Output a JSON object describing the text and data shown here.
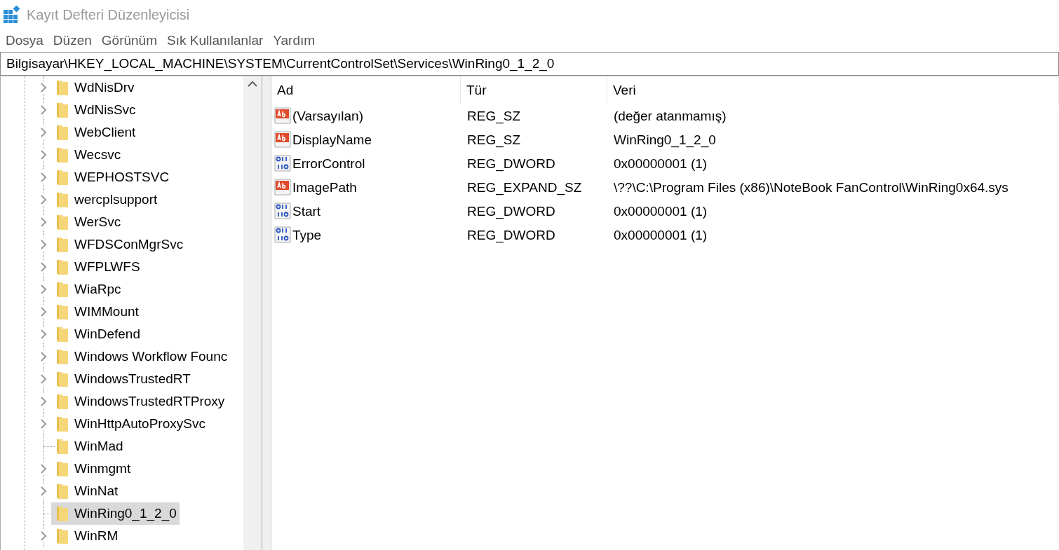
{
  "window": {
    "title": "Kayıt Defteri Düzenleyicisi"
  },
  "menu": [
    "Dosya",
    "Düzen",
    "Görünüm",
    "Sık Kullanılanlar",
    "Yardım"
  ],
  "address": "Bilgisayar\\HKEY_LOCAL_MACHINE\\SYSTEM\\CurrentControlSet\\Services\\WinRing0_1_2_0",
  "tree": [
    {
      "label": "WdNisDrv",
      "expandable": true,
      "selected": false
    },
    {
      "label": "WdNisSvc",
      "expandable": true,
      "selected": false
    },
    {
      "label": "WebClient",
      "expandable": true,
      "selected": false
    },
    {
      "label": "Wecsvc",
      "expandable": true,
      "selected": false
    },
    {
      "label": "WEPHOSTSVC",
      "expandable": true,
      "selected": false
    },
    {
      "label": "wercplsupport",
      "expandable": true,
      "selected": false
    },
    {
      "label": "WerSvc",
      "expandable": true,
      "selected": false
    },
    {
      "label": "WFDSConMgrSvc",
      "expandable": true,
      "selected": false
    },
    {
      "label": "WFPLWFS",
      "expandable": true,
      "selected": false
    },
    {
      "label": "WiaRpc",
      "expandable": true,
      "selected": false
    },
    {
      "label": "WIMMount",
      "expandable": true,
      "selected": false
    },
    {
      "label": "WinDefend",
      "expandable": true,
      "selected": false
    },
    {
      "label": "Windows Workflow Founc",
      "expandable": true,
      "selected": false
    },
    {
      "label": "WindowsTrustedRT",
      "expandable": true,
      "selected": false
    },
    {
      "label": "WindowsTrustedRTProxy",
      "expandable": true,
      "selected": false
    },
    {
      "label": "WinHttpAutoProxySvc",
      "expandable": true,
      "selected": false
    },
    {
      "label": "WinMad",
      "expandable": false,
      "selected": false
    },
    {
      "label": "Winmgmt",
      "expandable": true,
      "selected": false
    },
    {
      "label": "WinNat",
      "expandable": true,
      "selected": false
    },
    {
      "label": "WinRing0_1_2_0",
      "expandable": false,
      "selected": true
    },
    {
      "label": "WinRM",
      "expandable": true,
      "selected": false
    }
  ],
  "table": {
    "columns": [
      "Ad",
      "Tür",
      "Veri"
    ],
    "rows": [
      {
        "kind": "string",
        "name": "(Varsayılan)",
        "type": "REG_SZ",
        "data": "(değer atanmamış)"
      },
      {
        "kind": "string",
        "name": "DisplayName",
        "type": "REG_SZ",
        "data": "WinRing0_1_2_0"
      },
      {
        "kind": "binary",
        "name": "ErrorControl",
        "type": "REG_DWORD",
        "data": "0x00000001 (1)"
      },
      {
        "kind": "string",
        "name": "ImagePath",
        "type": "REG_EXPAND_SZ",
        "data": "\\??\\C:\\Program Files (x86)\\NoteBook FanControl\\WinRing0x64.sys"
      },
      {
        "kind": "binary",
        "name": "Start",
        "type": "REG_DWORD",
        "data": "0x00000001 (1)"
      },
      {
        "kind": "binary",
        "name": "Type",
        "type": "REG_DWORD",
        "data": "0x00000001 (1)"
      }
    ]
  }
}
